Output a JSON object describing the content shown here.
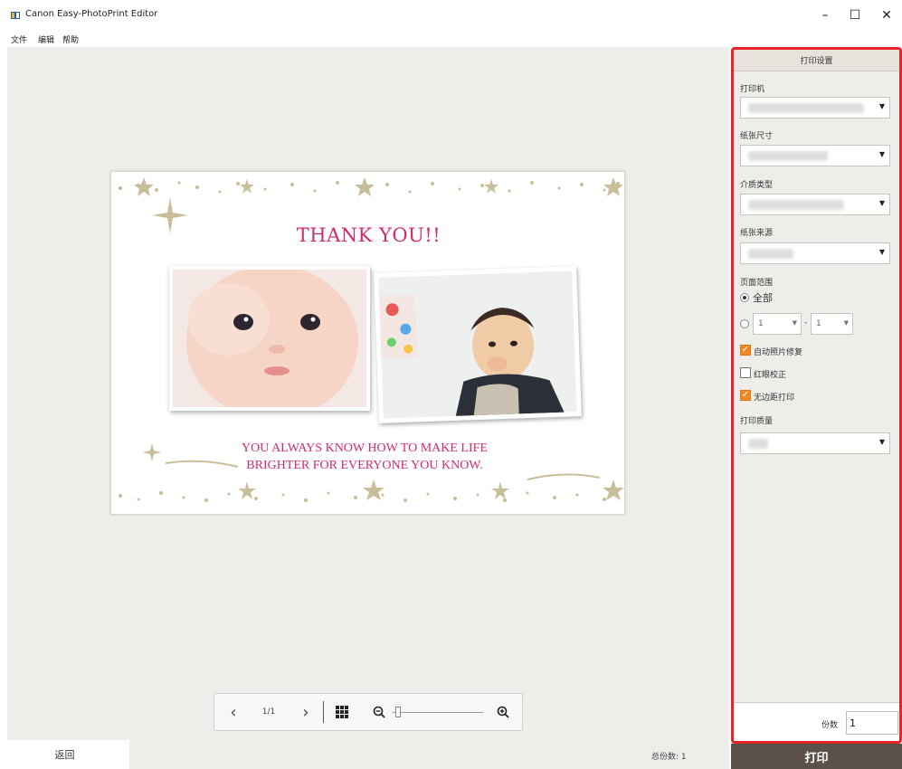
{
  "window": {
    "title": "Canon Easy-PhotoPrint Editor",
    "minimize_glyph": "–",
    "maximize_glyph": "☐",
    "close_glyph": "✕"
  },
  "menu": [
    "文件",
    "编辑",
    "帮助"
  ],
  "card": {
    "title": "THANK YOU!!",
    "message_line1": "YOU ALWAYS KNOW HOW TO MAKE LIFE",
    "message_line2": "BRIGHTER FOR EVERYONE YOU KNOW.",
    "accent_color": "#d42a6b",
    "decoration_color": "#c8bf9a"
  },
  "view_toolbar": {
    "prev_icon": "chevron-left-icon",
    "page_indicator": "1/1",
    "next_icon": "chevron-right-icon",
    "grid_icon": "grid-icon",
    "zoom_out_icon": "zoom-out-icon",
    "zoom_in_icon": "zoom-in-icon",
    "zoom_level": 0.03
  },
  "bottom": {
    "back_label": "返回",
    "total_count": "总份数: 1"
  },
  "panel": {
    "header": "打印设置",
    "printer_label": "打印机",
    "paper_size_label": "纸张尺寸",
    "media_type_label": "介质类型",
    "paper_source_label": "纸张来源",
    "page_range_label": "页面范围",
    "range_all_label": "全部",
    "range_from": "1",
    "range_dash": "-",
    "range_to": "1",
    "auto_photo_fix": {
      "label": "自动照片修复",
      "checked": true
    },
    "red_eye": {
      "label": "红眼校正",
      "checked": false
    },
    "borderless": {
      "label": "无边距打印",
      "checked": true
    },
    "print_quality_label": "打印质量",
    "copies_label": "份数",
    "copies_value": "1",
    "highlight_color": "#e8242a"
  },
  "print_button_label": "打印"
}
